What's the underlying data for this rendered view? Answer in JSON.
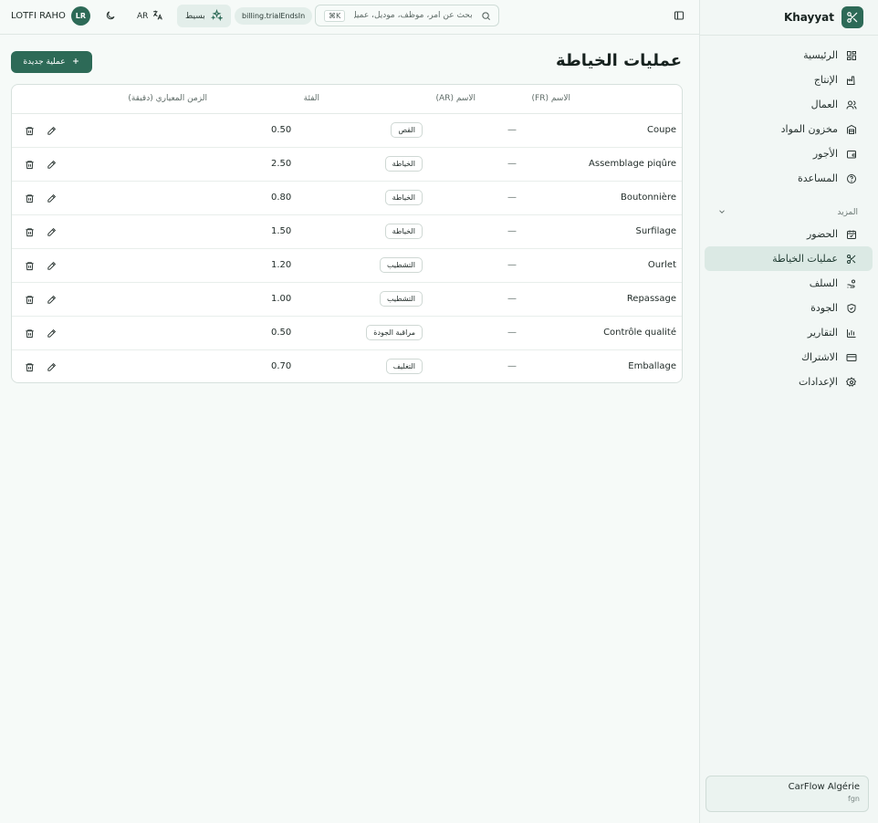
{
  "brand": {
    "name": "Khayyat",
    "icon": "scissors-icon"
  },
  "nav": {
    "items": [
      {
        "label": "الرئيسية",
        "icon": "dashboard-icon",
        "active": false
      },
      {
        "label": "الإنتاج",
        "icon": "production-icon",
        "active": false
      },
      {
        "label": "العمال",
        "icon": "users-icon",
        "active": false
      },
      {
        "label": "مخزون المواد",
        "icon": "warehouse-icon",
        "active": false
      },
      {
        "label": "الأجور",
        "icon": "wallet-icon",
        "active": false
      },
      {
        "label": "المساعدة",
        "icon": "help-icon",
        "active": false
      }
    ],
    "group_label": "المزيد",
    "more_items": [
      {
        "label": "الحضور",
        "icon": "calendar-check-icon",
        "active": false
      },
      {
        "label": "عمليات الخياطة",
        "icon": "scissors-icon",
        "active": true
      },
      {
        "label": "السلف",
        "icon": "hand-coins-icon",
        "active": false
      },
      {
        "label": "الجودة",
        "icon": "shield-check-icon",
        "active": false
      },
      {
        "label": "التقارير",
        "icon": "bar-chart-icon",
        "active": false
      },
      {
        "label": "الاشتراك",
        "icon": "credit-card-icon",
        "active": false
      },
      {
        "label": "الإعدادات",
        "icon": "gear-icon",
        "active": false
      }
    ]
  },
  "workspace": {
    "name": "CarFlow Algérie",
    "sub": "fgn"
  },
  "topbar": {
    "user_name": "LOTFI RAHO",
    "avatar_initials": "LR",
    "language": "AR",
    "plan_label": "بسيط",
    "trial_label": "billing.trialEndsIn",
    "search_placeholder": "بحث عن أمر، موظف، موديل، عميل...",
    "search_shortcut": "⌘K"
  },
  "page": {
    "title": "عمليات الخياطة",
    "new_button_label": "عملية جديدة"
  },
  "table": {
    "headers": {
      "name_fr": "الاسم (FR)",
      "name_ar": "الاسم (AR)",
      "category": "الفئة",
      "std_time": "الزمن المعياري (دقيقة)"
    },
    "rows": [
      {
        "name_fr": "Coupe",
        "name_ar": "—",
        "category": "القص",
        "time": "0.50"
      },
      {
        "name_fr": "Assemblage piqûre",
        "name_ar": "—",
        "category": "الخياطة",
        "time": "2.50"
      },
      {
        "name_fr": "Boutonnière",
        "name_ar": "—",
        "category": "الخياطة",
        "time": "0.80"
      },
      {
        "name_fr": "Surfilage",
        "name_ar": "—",
        "category": "الخياطة",
        "time": "1.50"
      },
      {
        "name_fr": "Ourlet",
        "name_ar": "—",
        "category": "التشطيب",
        "time": "1.20"
      },
      {
        "name_fr": "Repassage",
        "name_ar": "—",
        "category": "التشطيب",
        "time": "1.00"
      },
      {
        "name_fr": "Contrôle qualité",
        "name_ar": "—",
        "category": "مراقبة الجودة",
        "time": "0.50"
      },
      {
        "name_fr": "Emballage",
        "name_ar": "—",
        "category": "التغليف",
        "time": "0.70"
      }
    ]
  },
  "colors": {
    "accent": "#2d6a57",
    "active_bg": "#dbe9e4",
    "background": "#f6faf8"
  }
}
